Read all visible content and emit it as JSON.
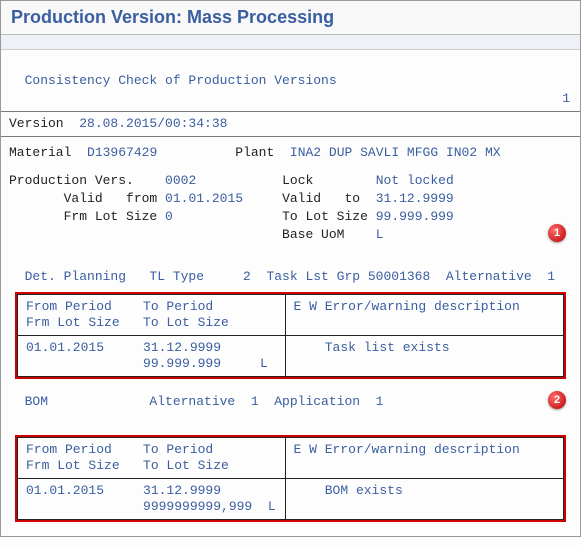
{
  "title": "Production Version: Mass Processing",
  "header": {
    "line_label": "Consistency Check of Production Versions",
    "page_no": "1",
    "version_label": "Version",
    "version_value": "28.08.2015/00:34:38"
  },
  "material": {
    "label": "Material",
    "value": "D13967429",
    "plant_label": "Plant",
    "plant_code": "INA2",
    "plant_desc": "DUP SAVLI MFGG IN02 MX"
  },
  "prodvers": {
    "label": "Production Vers.",
    "value": "0002",
    "lock_label": "Lock",
    "lock_value": "Not locked",
    "valid_label": "Valid   from",
    "valid_from": "01.01.2015",
    "valid2_label": "Valid   to",
    "valid_to": "31.12.9999",
    "frm_label": "Frm Lot Size",
    "frm_value": "0",
    "to_lot_label": "To Lot Size",
    "to_lot_value": "99.999.999",
    "uom_label": "Base UoM",
    "uom_value": "L"
  },
  "section1": {
    "callout": "1",
    "l1": "  Det. Planning   TL Type     2  Task Lst Grp 50001368  Alternative  1",
    "hdr_left": "From Period    To Period\nFrm Lot Size   To Lot Size",
    "hdr_right": "E W Error/warning description",
    "row_left": "01.01.2015     31.12.9999\n               99.999.999     L",
    "row_right": "    Task list exists"
  },
  "section2": {
    "callout": "2",
    "l1": "  BOM             Alternative  1  Application  1",
    "hdr_left": "From Period    To Period\nFrm Lot Size   To Lot Size",
    "hdr_right": "E W Error/warning description",
    "row_left": "01.01.2015     31.12.9999\n               9999999999,999  L",
    "row_right": "    BOM exists"
  }
}
